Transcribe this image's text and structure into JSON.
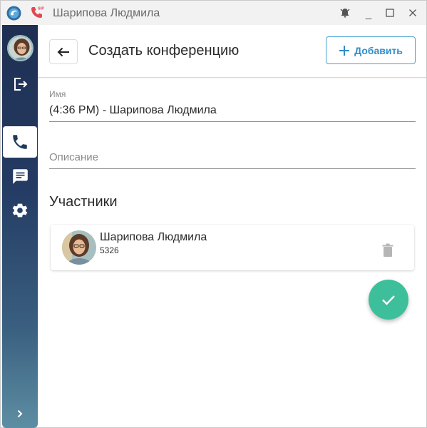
{
  "window": {
    "title": "Шарипова Людмила",
    "sip_badge": "SIP",
    "controls": {
      "minimize": "_"
    }
  },
  "sidebar": {
    "items": [
      {
        "name": "logout",
        "icon": "logout-icon"
      },
      {
        "name": "calls",
        "icon": "phone-icon",
        "active": true
      },
      {
        "name": "chat",
        "icon": "chat-icon"
      },
      {
        "name": "settings",
        "icon": "gear-icon"
      }
    ],
    "expand_icon": "chevron-right-icon"
  },
  "header": {
    "title": "Создать конференцию",
    "add_label": "Добавить"
  },
  "form": {
    "name_label": "Имя",
    "name_value": "(4:36 PM) - Шарипова Людмила",
    "description_placeholder": "Описание"
  },
  "participants": {
    "title": "Участники",
    "items": [
      {
        "name": "Шарипова Людмила",
        "number": "5326"
      }
    ]
  },
  "colors": {
    "accent": "#2f8dc9",
    "fab": "#3cbf9a",
    "sidebar_top": "#1f2f52",
    "sidebar_bottom": "#5d8ea3",
    "phone_red": "#e2474f"
  }
}
